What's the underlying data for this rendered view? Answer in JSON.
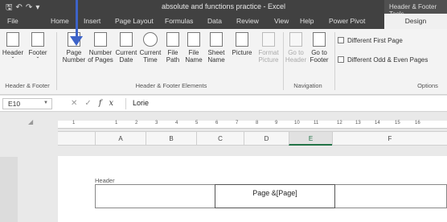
{
  "window": {
    "title": "absolute and functions practice  -  Excel",
    "contextual_tab_header": "Header & Footer Tools",
    "qat_icons": [
      "save-icon",
      "undo-icon",
      "redo-icon",
      "customize-icon"
    ]
  },
  "tabs": [
    "File",
    "Home",
    "Insert",
    "Page Layout",
    "Formulas",
    "Data",
    "Review",
    "View",
    "Help",
    "Power Pivot",
    "Design"
  ],
  "active_tab": "Design",
  "ribbon": {
    "header_footer_group": {
      "label": "Header & Footer",
      "buttons": [
        {
          "line1": "Header",
          "line2": "ˇ"
        },
        {
          "line1": "Footer",
          "line2": "ˇ"
        }
      ]
    },
    "elements_group": {
      "label": "Header & Footer Elements",
      "buttons": [
        {
          "line1": "Page",
          "line2": "Number"
        },
        {
          "line1": "Number",
          "line2": "of Pages"
        },
        {
          "line1": "Current",
          "line2": "Date"
        },
        {
          "line1": "Current",
          "line2": "Time"
        },
        {
          "line1": "File",
          "line2": "Path"
        },
        {
          "line1": "File",
          "line2": "Name"
        },
        {
          "line1": "Sheet",
          "line2": "Name"
        },
        {
          "line1": "Picture",
          "line2": ""
        },
        {
          "line1": "Format",
          "line2": "Picture"
        }
      ]
    },
    "navigation_group": {
      "label": "Navigation",
      "buttons": [
        {
          "line1": "Go to",
          "line2": "Header"
        },
        {
          "line1": "Go to",
          "line2": "Footer"
        }
      ]
    },
    "options_group": {
      "label": "Options",
      "checkboxes": [
        "Different First Page",
        "Different Odd & Even Pages"
      ]
    }
  },
  "formula_bar": {
    "name_box": "E10",
    "formula": "Lorie",
    "icons": [
      "cancel-icon",
      "enter-icon",
      "fx-icon"
    ]
  },
  "sheet": {
    "ruler_numbers": [
      "1",
      "1",
      "2",
      "3",
      "4",
      "5",
      "6",
      "7",
      "8",
      "9",
      "10",
      "11",
      "12",
      "13",
      "14",
      "15",
      "16"
    ],
    "columns": [
      "A",
      "B",
      "C",
      "D",
      "E",
      "F"
    ],
    "selected_column": "E",
    "header_label": "Header",
    "header_center_text": "Page &[Page]"
  }
}
